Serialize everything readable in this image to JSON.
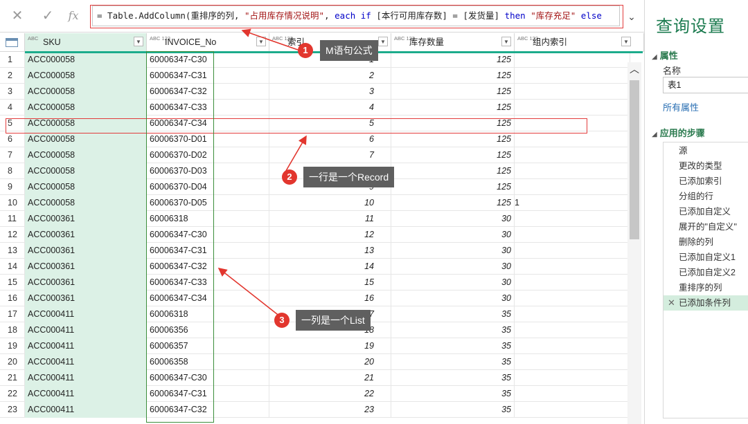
{
  "formula_bar": {
    "cancel_icon": "close-icon",
    "commit_icon": "check-icon",
    "fx_label": "fx",
    "formula_parts": [
      {
        "t": "= Table.AddColumn(重排序的列, ",
        "k": "plain"
      },
      {
        "t": "\"占用库存情况说明\"",
        "k": "str"
      },
      {
        "t": ", ",
        "k": "plain"
      },
      {
        "t": "each if",
        "k": "kw"
      },
      {
        "t": " [本行可用库存数] = [发货量] ",
        "k": "plain"
      },
      {
        "t": "then",
        "k": "kw"
      },
      {
        "t": " ",
        "k": "plain"
      },
      {
        "t": "\"库存充足\"",
        "k": "str"
      },
      {
        "t": " ",
        "k": "plain"
      },
      {
        "t": "else",
        "k": "kw"
      }
    ]
  },
  "columns": [
    {
      "type": "ABC",
      "label": "SKU"
    },
    {
      "type": "ABC 123",
      "label": "INVOICE_No"
    },
    {
      "type": "ABC 123",
      "label": "索引"
    },
    {
      "type": "ABC 123",
      "label": "库存数量"
    },
    {
      "type": "ABC 123",
      "label": "组内索引"
    }
  ],
  "rows": [
    {
      "n": "1",
      "sku": "ACC000058",
      "inv": "60006347-C30",
      "idx": "1",
      "qty": "125",
      "grp": ""
    },
    {
      "n": "2",
      "sku": "ACC000058",
      "inv": "60006347-C31",
      "idx": "2",
      "qty": "125",
      "grp": ""
    },
    {
      "n": "3",
      "sku": "ACC000058",
      "inv": "60006347-C32",
      "idx": "3",
      "qty": "125",
      "grp": ""
    },
    {
      "n": "4",
      "sku": "ACC000058",
      "inv": "60006347-C33",
      "idx": "4",
      "qty": "125",
      "grp": ""
    },
    {
      "n": "5",
      "sku": "ACC000058",
      "inv": "60006347-C34",
      "idx": "5",
      "qty": "125",
      "grp": ""
    },
    {
      "n": "6",
      "sku": "ACC000058",
      "inv": "60006370-D01",
      "idx": "6",
      "qty": "125",
      "grp": ""
    },
    {
      "n": "7",
      "sku": "ACC000058",
      "inv": "60006370-D02",
      "idx": "7",
      "qty": "125",
      "grp": ""
    },
    {
      "n": "8",
      "sku": "ACC000058",
      "inv": "60006370-D03",
      "idx": "8",
      "qty": "125",
      "grp": ""
    },
    {
      "n": "9",
      "sku": "ACC000058",
      "inv": "60006370-D04",
      "idx": "9",
      "qty": "125",
      "grp": ""
    },
    {
      "n": "10",
      "sku": "ACC000058",
      "inv": "60006370-D05",
      "idx": "10",
      "qty": "125",
      "grp": "1"
    },
    {
      "n": "11",
      "sku": "ACC000361",
      "inv": "60006318",
      "idx": "11",
      "qty": "30",
      "grp": ""
    },
    {
      "n": "12",
      "sku": "ACC000361",
      "inv": "60006347-C30",
      "idx": "12",
      "qty": "30",
      "grp": ""
    },
    {
      "n": "13",
      "sku": "ACC000361",
      "inv": "60006347-C31",
      "idx": "13",
      "qty": "30",
      "grp": ""
    },
    {
      "n": "14",
      "sku": "ACC000361",
      "inv": "60006347-C32",
      "idx": "14",
      "qty": "30",
      "grp": ""
    },
    {
      "n": "15",
      "sku": "ACC000361",
      "inv": "60006347-C33",
      "idx": "15",
      "qty": "30",
      "grp": ""
    },
    {
      "n": "16",
      "sku": "ACC000361",
      "inv": "60006347-C34",
      "idx": "16",
      "qty": "30",
      "grp": ""
    },
    {
      "n": "17",
      "sku": "ACC000411",
      "inv": "60006318",
      "idx": "17",
      "qty": "35",
      "grp": ""
    },
    {
      "n": "18",
      "sku": "ACC000411",
      "inv": "60006356",
      "idx": "18",
      "qty": "35",
      "grp": ""
    },
    {
      "n": "19",
      "sku": "ACC000411",
      "inv": "60006357",
      "idx": "19",
      "qty": "35",
      "grp": ""
    },
    {
      "n": "20",
      "sku": "ACC000411",
      "inv": "60006358",
      "idx": "20",
      "qty": "35",
      "grp": ""
    },
    {
      "n": "21",
      "sku": "ACC000411",
      "inv": "60006347-C30",
      "idx": "21",
      "qty": "35",
      "grp": ""
    },
    {
      "n": "22",
      "sku": "ACC000411",
      "inv": "60006347-C31",
      "idx": "22",
      "qty": "35",
      "grp": ""
    },
    {
      "n": "23",
      "sku": "ACC000411",
      "inv": "60006347-C32",
      "idx": "23",
      "qty": "35",
      "grp": ""
    }
  ],
  "settings": {
    "title": "查询设置",
    "properties_header": "属性",
    "name_label": "名称",
    "name_value": "表1",
    "all_properties": "所有属性",
    "steps_header": "应用的步骤",
    "steps": [
      "源",
      "更改的类型",
      "已添加索引",
      "分组的行",
      "已添加自定义",
      "展开的\"自定义\"",
      "删除的列",
      "已添加自定义1",
      "已添加自定义2",
      "重排序的列",
      "已添加条件列"
    ]
  },
  "annotations": {
    "a1": {
      "num": "1",
      "text": "M语句公式"
    },
    "a2": {
      "num": "2",
      "text": "一行是一个Record"
    },
    "a3": {
      "num": "3",
      "text": "一列是一个List"
    }
  },
  "colors": {
    "accent": "#1cac8c",
    "annotation": "#e2362e",
    "list_box": "#3a8d3a"
  }
}
